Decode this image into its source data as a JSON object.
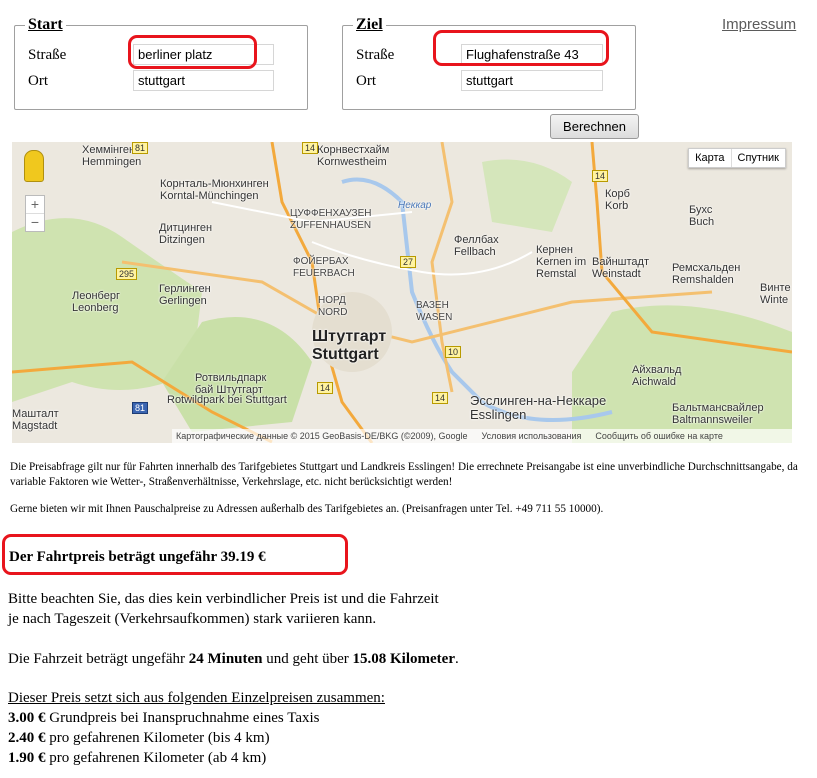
{
  "start": {
    "legend": "Start",
    "street_label": "Straße",
    "street_value": "berliner platz",
    "city_label": "Ort",
    "city_value": "stuttgart"
  },
  "ziel": {
    "legend": "Ziel",
    "street_label": "Straße",
    "street_value": "Flughafenstraße 43",
    "city_label": "Ort",
    "city_value": "stuttgart"
  },
  "impressum": "Impressum",
  "calc_button": "Berechnen",
  "highlight_color": "#e8141c",
  "map": {
    "type_map": "Карта",
    "type_satellite": "Спутник",
    "zoom_in": "+",
    "zoom_out": "−",
    "attribution": "Картографические данные © 2015 GeoBasis-DE/BKG (©2009), Google",
    "terms": "Условия использования",
    "report": "Сообщить об ошибке на карте",
    "labels": [
      {
        "a": "Хеммінген",
        "b": "Hemmingen"
      },
      {
        "a": "Корнвестхайм",
        "b": "Kornwestheim"
      },
      {
        "a": "Корнталь-Мюнхинген",
        "b": "Korntal-Münchingen"
      },
      {
        "a": "ЦУФФЕНХАУЗЕН",
        "b": "ZUFFENHAUSEN"
      },
      {
        "a": "Дитцинген",
        "b": "Ditzingen"
      },
      {
        "a": "ФОЙЕРБАХ",
        "b": "FEUERBACH"
      },
      {
        "a": "Феллбах",
        "b": "Fellbach"
      },
      {
        "a": "Кернен",
        "b": "Kernen im"
      },
      {
        "a": "Remstal",
        "b": ""
      },
      {
        "a": "Вайнштадт",
        "b": "Weinstadt"
      },
      {
        "a": "Корб",
        "b": "Korb"
      },
      {
        "a": "Бухс",
        "b": "Buch"
      },
      {
        "a": "Ремсхальден",
        "b": "Remshalden"
      },
      {
        "a": "Винте",
        "b": "Winte"
      },
      {
        "a": "Леонберг",
        "b": "Leonberg"
      },
      {
        "a": "Герлинген",
        "b": "Gerlingen"
      },
      {
        "a": "НОРД",
        "b": "NORD"
      },
      {
        "a": "ВАЗЕН",
        "b": "WASEN"
      },
      {
        "a": "Штутгарт",
        "b": "Stuttgart"
      },
      {
        "a": "Ротвильдпарк",
        "b": "бай Штутгарт"
      },
      {
        "a": "Rotwildpark bei Stuttgart",
        "b": ""
      },
      {
        "a": "Айхвальд",
        "b": "Aichwald"
      },
      {
        "a": "Эсслинген-на-Неккаре",
        "b": "Esslingen"
      },
      {
        "a": "Бальтмансвайлер",
        "b": "Baltmannsweiler"
      },
      {
        "a": "Машталт",
        "b": "Magstadt"
      },
      {
        "a": "Неккар",
        "b": ""
      }
    ],
    "shields": [
      "81",
      "14",
      "295",
      "27",
      "14",
      "10",
      "81",
      "14",
      "14"
    ]
  },
  "notice1": "Die Preisabfrage gilt nur für Fahrten innerhalb des Tarifgebietes Stuttgart und Landkreis Esslingen! Die errechnete Preisangabe ist eine unverbindliche Durchschnittsangabe, da variable Faktoren wie Wetter-, Straßenverhältnisse, Verkehrslage, etc. nicht berücksichtigt werden!",
  "notice2": "Gerne bieten wir mit Ihnen Pauschalpreise zu Adressen außerhalb des Tarifgebietes an. (Preisanfragen unter Tel. +49 711 55 10000).",
  "price_line": "Der Fahrtpreis beträgt ungefähr 39.19 €",
  "disclaimer_1": "Bitte beachten Sie, das dies kein verbindlicher Preis ist und die Fahrzeit",
  "disclaimer_2": "je nach Tageszeit (Verkehrsaufkommen) stark variieren kann.",
  "duration": {
    "prefix": "Die Fahrzeit beträgt ungefähr ",
    "time": "24 Minuten",
    "middle": " und geht über ",
    "distance": "15.08 Kilometer",
    "suffix": "."
  },
  "breakdown_title": "Dieser Preis setzt sich aus folgenden Einzelpreisen zusammen:",
  "breakdown": [
    {
      "amount": "3.00 €",
      "text": " Grundpreis bei Inanspruchnahme eines Taxis"
    },
    {
      "amount": "2.40 €",
      "text": " pro gefahrenen Kilometer (bis 4 km)"
    },
    {
      "amount": "1.90 €",
      "text": " pro gefahrenen Kilometer (ab 4 km)"
    }
  ]
}
